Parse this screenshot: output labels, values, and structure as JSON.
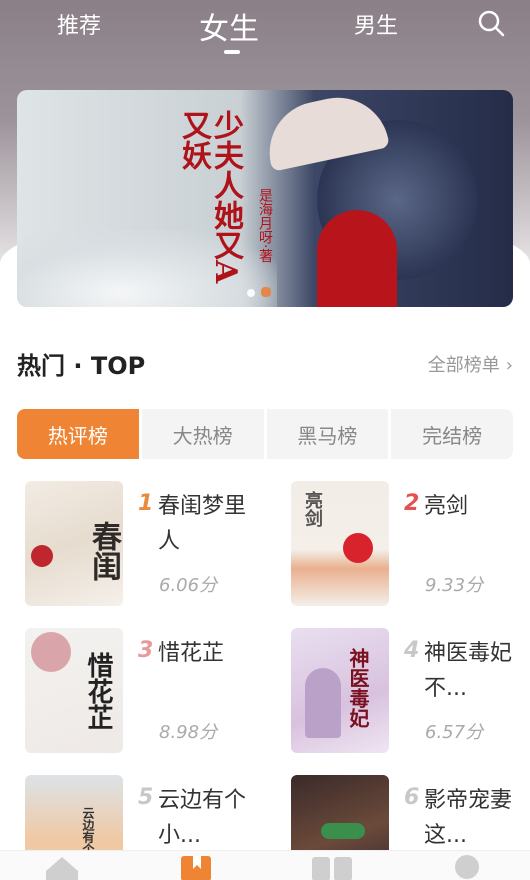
{
  "nav": {
    "tabs": [
      {
        "label": "推荐"
      },
      {
        "label": "女生"
      },
      {
        "label": "男生"
      }
    ],
    "active_tab": "女生"
  },
  "banner": {
    "title": "少夫人她又A又妖",
    "author": "是海月呀·著",
    "slides": 2,
    "active_slide": 2
  },
  "section": {
    "title": "热门 · TOP",
    "more_label": "全部榜单"
  },
  "rank_tabs": [
    {
      "label": "热评榜",
      "active": true
    },
    {
      "label": "大热榜",
      "active": false
    },
    {
      "label": "黑马榜",
      "active": false
    },
    {
      "label": "完结榜",
      "active": false
    }
  ],
  "books": [
    {
      "rank": "1",
      "name": "春闺梦里人",
      "score": "6.06分",
      "cover_text": "春闺"
    },
    {
      "rank": "2",
      "name": "亮剑",
      "score": "9.33分",
      "cover_text": "亮剑"
    },
    {
      "rank": "3",
      "name": "惜花芷",
      "score": "8.98分",
      "cover_text": "惜花芷"
    },
    {
      "rank": "4",
      "name": "神医毒妃不...",
      "score": "6.57分",
      "cover_text": "神医毒妃"
    },
    {
      "rank": "5",
      "name": "云边有个小...",
      "score": "",
      "cover_text": "云边有个小卖部"
    },
    {
      "rank": "6",
      "name": "影帝宠妻这...",
      "score": "",
      "cover_text": ""
    }
  ],
  "colors": {
    "accent": "#ee8434",
    "rank1": "#e98a3d",
    "rank2": "#e55050",
    "rank3": "#e89a9a",
    "rank_other": "#c8c8c8"
  }
}
